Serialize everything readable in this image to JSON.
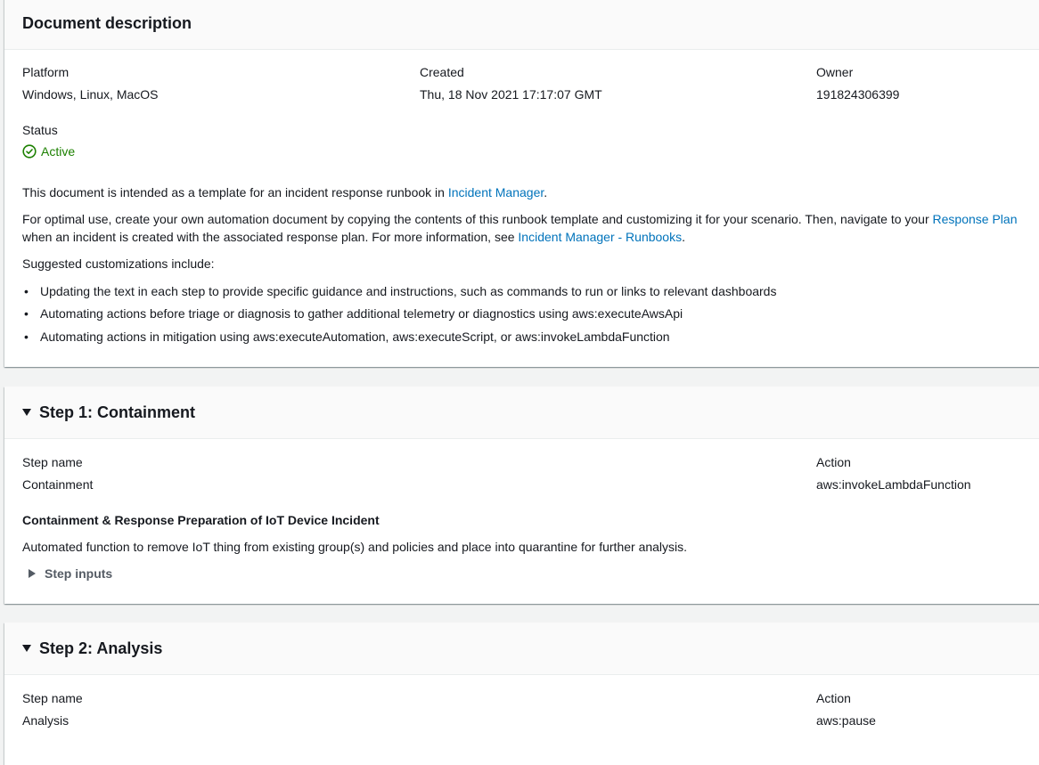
{
  "description": {
    "title": "Document description",
    "platform_label": "Platform",
    "platform_value": "Windows, Linux, MacOS",
    "created_label": "Created",
    "created_value": "Thu, 18 Nov 2021 17:17:07 GMT",
    "owner_label": "Owner",
    "owner_value": "191824306399",
    "status_label": "Status",
    "status_value": "Active",
    "status_color": "#1d8102",
    "intro_text": "This document is intended as a template for an incident response runbook in ",
    "intro_link": "Incident Manager",
    "intro_end": ".",
    "optimal_text": "For optimal use, create your own automation document by copying the contents of this runbook template and customizing it for your scenario. Then, navigate to your ",
    "optimal_link": "Response Plan",
    "optimal_text2": "when an incident is created with the associated response plan. For more information, see ",
    "optimal_link2": "Incident Manager - Runbooks",
    "optimal_end": ".",
    "suggested_label": "Suggested customizations include:",
    "bullets": [
      "Updating the text in each step to provide specific guidance and instructions, such as commands to run or links to relevant dashboards",
      "Automating actions before triage or diagnosis to gather additional telemetry or diagnostics using aws:executeAwsApi",
      "Automating actions in mitigation using aws:executeAutomation, aws:executeScript, or aws:invokeLambdaFunction"
    ]
  },
  "step1": {
    "title": "Step 1: Containment",
    "step_name_label": "Step name",
    "step_name_value": "Containment",
    "action_label": "Action",
    "action_value": "aws:invokeLambdaFunction",
    "heading": "Containment & Response Preparation of IoT Device Incident",
    "description": "Automated function to remove IoT thing from existing group(s) and policies and place into quarantine for further analysis.",
    "inputs_label": "Step inputs"
  },
  "step2": {
    "title": "Step 2: Analysis",
    "step_name_label": "Step name",
    "step_name_value": "Analysis",
    "action_label": "Action",
    "action_value": "aws:pause"
  },
  "colors": {
    "link": "#0073bb",
    "background": "#f2f3f3",
    "active": "#1d8102"
  }
}
